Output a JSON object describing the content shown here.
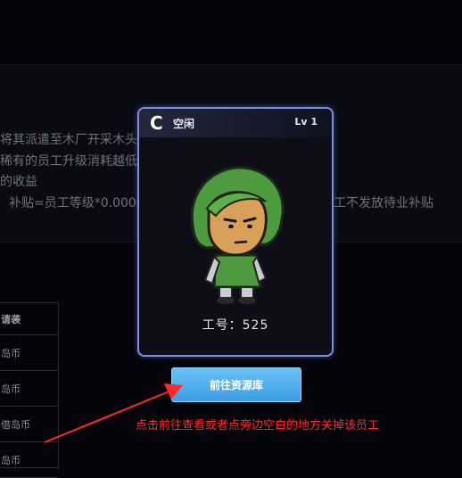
{
  "background": {
    "lines": [
      "将其派遣至木厂开采木头等。",
      "稀有的员工升级消耗越低;",
      "的收益",
      "补贴=员工等级*0.000656",
      "状态的员工不发放待业补贴"
    ],
    "table": {
      "header": "请袭",
      "rows": [
        "岛币",
        "岛币",
        "借岛币",
        "岛币"
      ]
    }
  },
  "card": {
    "rank": "C",
    "status": "空闲",
    "level": "Lv 1",
    "employee_number": "工号：525"
  },
  "button": {
    "label": "前往资源库"
  },
  "annotation": {
    "text": "点击前往查看或者点旁边空白的地方关掉该员工"
  },
  "colors": {
    "card_border": "#7f8de0",
    "button": "#4aa8ec",
    "annotation": "#ff2a2a"
  }
}
